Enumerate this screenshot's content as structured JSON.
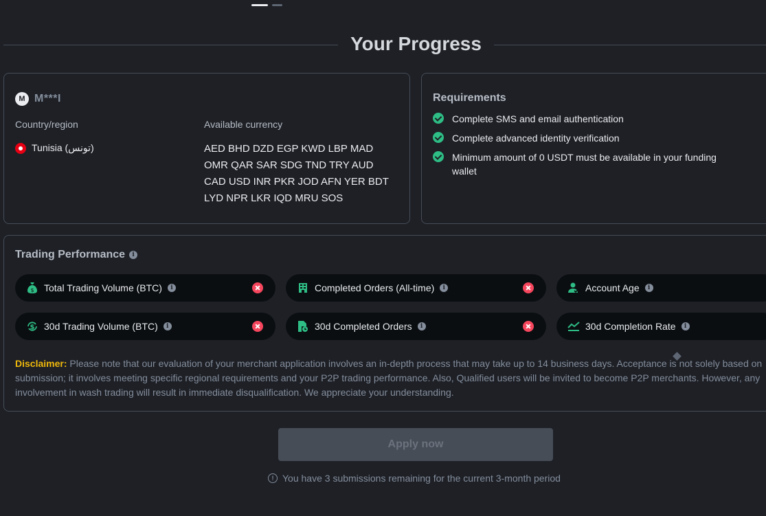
{
  "page": {
    "title": "Your Progress"
  },
  "user": {
    "avatar_letter": "M",
    "name": "M***I",
    "country_label": "Country/region",
    "country_value": "Tunisia (تونس)",
    "currency_label": "Available currency",
    "currencies": "AED BHD DZD EGP KWD LBP MAD OMR QAR SAR SDG TND TRY AUD CAD USD INR PKR JOD AFN YER BDT LYD NPR LKR IQD MRU SOS"
  },
  "requirements": {
    "title": "Requirements",
    "items": [
      {
        "text": "Complete SMS and email authentication",
        "status": "done"
      },
      {
        "text": "Complete advanced identity verification",
        "status": "done"
      },
      {
        "text": "Minimum amount of 0 USDT must be available in your funding wallet",
        "status": "done"
      }
    ]
  },
  "performance": {
    "title": "Trading Performance",
    "metrics": [
      {
        "label": "Total Trading Volume (BTC)",
        "icon": "money-bag-icon",
        "status": "failed"
      },
      {
        "label": "Completed Orders (All-time)",
        "icon": "building-icon",
        "status": "failed"
      },
      {
        "label": "Account Age",
        "icon": "user-check-icon",
        "status": "unknown"
      },
      {
        "label": "30d Trading Volume (BTC)",
        "icon": "dollar-cycle-icon",
        "status": "failed"
      },
      {
        "label": "30d Completed Orders",
        "icon": "document-clock-icon",
        "status": "failed"
      },
      {
        "label": "30d Completion Rate",
        "icon": "trend-chart-icon",
        "status": "unknown"
      }
    ]
  },
  "disclaimer": {
    "heading": "Disclaimer:",
    "text": " Please note that our evaluation of your merchant application involves an in-depth process that may take up to 14 business days. Acceptance is not solely based on submission; it involves meeting specific regional requirements and your P2P trading performance. Also, Qualified users will be invited to become P2P merchants. However, any involvement in wash trading will result in immediate disqualification. We appreciate your understanding."
  },
  "apply": {
    "button_label": "Apply now",
    "note": "You have 3 submissions remaining for the current 3-month period"
  },
  "colors": {
    "background": "#1e2026",
    "accent_yellow": "#f0b90b",
    "success_green": "#2ebd85",
    "error_red": "#f6465d"
  }
}
